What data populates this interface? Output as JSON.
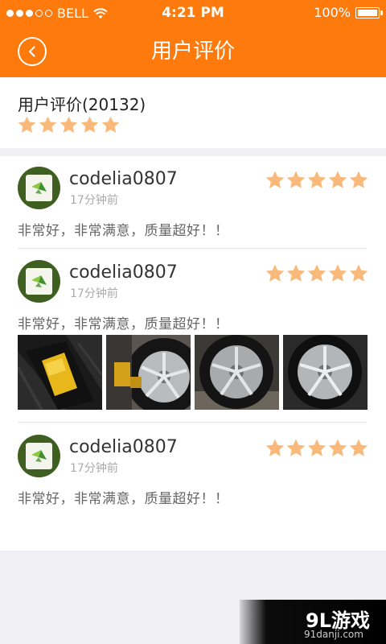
{
  "status_bar": {
    "carrier": "BELL",
    "time": "4:21 PM",
    "battery": "100%"
  },
  "header": {
    "title": "用户评价",
    "back_icon": "chevron-left-icon"
  },
  "summary": {
    "title": "用户评价(20132)",
    "rating": 5,
    "max_rating": 5
  },
  "colors": {
    "accent": "#ff7a0c",
    "star": "#f8b97a"
  },
  "reviews": [
    {
      "username": "codelia0807",
      "time_ago": "17分钟前",
      "rating": 5,
      "text": "非常好，非常满意，质量超好！！",
      "photo_count": 0
    },
    {
      "username": "codelia0807",
      "time_ago": "17分钟前",
      "rating": 5,
      "text": "非常好，非常满意，质量超好！！",
      "photo_count": 4
    },
    {
      "username": "codelia0807",
      "time_ago": "17分钟前",
      "rating": 5,
      "text": "非常好，非常满意，质量超好！！",
      "photo_count": 0
    }
  ],
  "watermark": {
    "brand": "9L游戏",
    "url": "91danji.com"
  }
}
